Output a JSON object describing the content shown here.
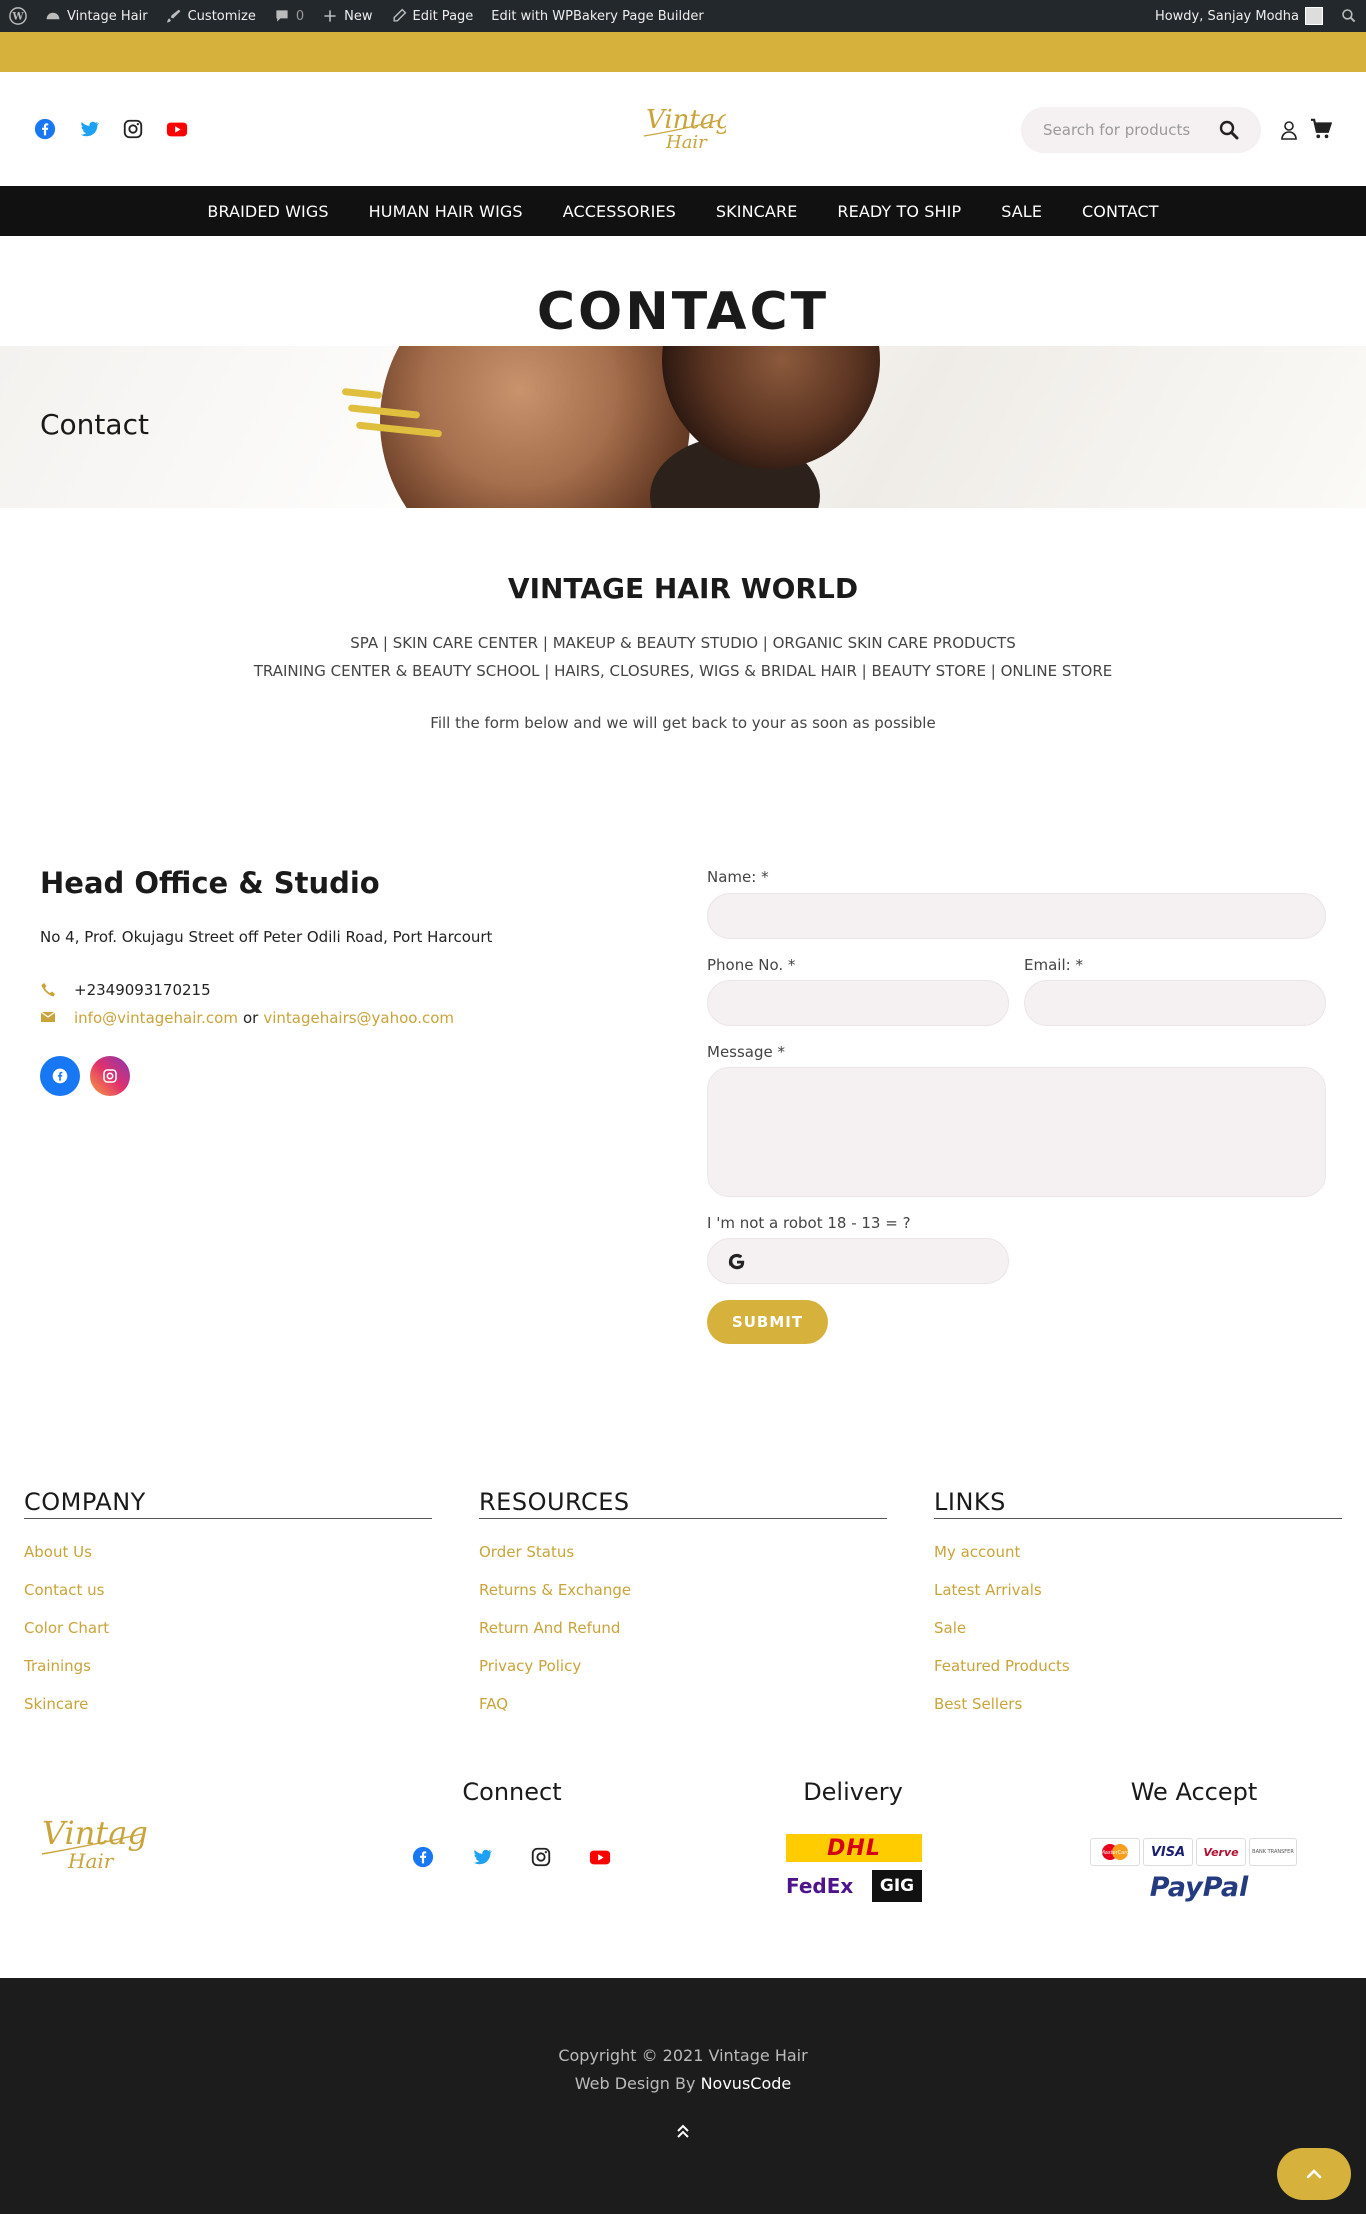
{
  "admin_bar": {
    "site_name": "Vintage Hair",
    "customize": "Customize",
    "comments_count": "0",
    "new_label": "New",
    "edit_page": "Edit Page",
    "wpbakery": "Edit with WPBakery Page Builder",
    "howdy": "Howdy, Sanjay Modha"
  },
  "header": {
    "search_placeholder": "Search for products",
    "social_icons": [
      "facebook-icon",
      "twitter-icon",
      "instagram-icon",
      "youtube-icon"
    ]
  },
  "nav": {
    "items": [
      "BRAIDED WIGS",
      "HUMAN HAIR WIGS",
      "ACCESSORIES",
      "SKINCARE",
      "READY TO SHIP",
      "SALE",
      "CONTACT"
    ]
  },
  "page": {
    "title": "CONTACT",
    "banner_title": "Contact"
  },
  "intro": {
    "heading": "VINTAGE HAIR WORLD",
    "line1": "SPA | SKIN CARE CENTER | MAKEUP & BEAUTY STUDIO | ORGANIC SKIN CARE PRODUCTS",
    "line2": "TRAINING CENTER & BEAUTY SCHOOL | HAIRS, CLOSURES, WIGS & BRIDAL HAIR | BEAUTY STORE | ONLINE STORE",
    "line3": "Fill the form below and we will get back to your as soon as possible"
  },
  "office": {
    "heading": "Head Office & Studio",
    "address": "No 4, Prof. Okujagu Street off Peter Odili Road, Port Harcourt",
    "phone": "+2349093170215",
    "email1": "info@vintagehair.com",
    "or": "or",
    "email2": "vintagehairs@yahoo.com"
  },
  "form": {
    "name_label": "Name: *",
    "phone_label": "Phone No. *",
    "email_label": "Email: *",
    "message_label": "Message *",
    "captcha_label": "I 'm not a robot 18 - 13 = ?",
    "submit": "SUBMIT"
  },
  "footer": {
    "company": {
      "title": "COMPANY",
      "links": [
        "About Us",
        "Contact us",
        "Color Chart",
        "Trainings",
        "Skincare"
      ]
    },
    "resources": {
      "title": "RESOURCES",
      "links": [
        "Order Status",
        "Returns & Exchange",
        "Return And Refund",
        "Privacy Policy",
        "FAQ"
      ]
    },
    "links": {
      "title": "LINKS",
      "links": [
        "My account",
        "Latest Arrivals",
        "Sale",
        "Featured Products",
        "Best Sellers"
      ]
    },
    "connect": "Connect",
    "delivery": "Delivery",
    "we_accept": "We Accept",
    "delivery_logos": [
      "DHL",
      "FedEx",
      "GIG"
    ],
    "payment_logos": [
      "MasterCard",
      "VISA",
      "Verve",
      "BANK TRANSFER",
      "PayPal"
    ]
  },
  "bottom": {
    "copyright": "Copyright © 2021 Vintage Hair",
    "webdesign": "Web Design By",
    "designer": "NovusCode"
  },
  "colors": {
    "gold": "#d6b23c",
    "dark": "#111111"
  }
}
